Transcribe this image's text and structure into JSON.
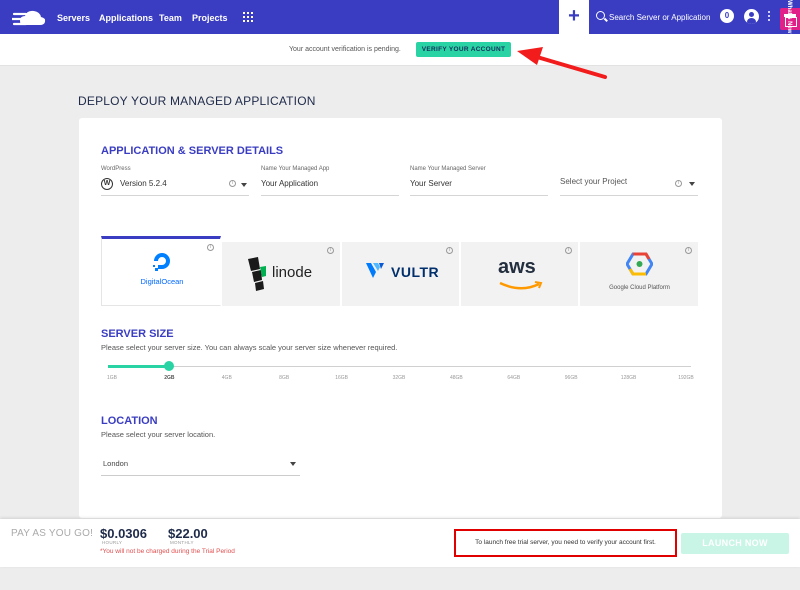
{
  "nav": {
    "items": [
      "Servers",
      "Applications",
      "Team",
      "Projects"
    ],
    "search_placeholder": "Search Server or Application",
    "notification_count": "0",
    "side_tab_label": "What's New"
  },
  "verify": {
    "text": "Your account verification is pending.",
    "button": "VERIFY YOUR ACCOUNT"
  },
  "page_title": "DEPLOY YOUR MANAGED APPLICATION",
  "details": {
    "title": "APPLICATION & SERVER DETAILS",
    "app_label": "WordPress",
    "app_version": "Version 5.2.4",
    "app_name_label": "Name Your Managed App",
    "app_name_value": "Your Application",
    "server_name_label": "Name Your Managed Server",
    "server_name_value": "Your Server",
    "project_placeholder": "Select your Project"
  },
  "providers": [
    {
      "name": "DigitalOcean",
      "active": true
    },
    {
      "name": "linode",
      "active": false
    },
    {
      "name": "VULTR",
      "active": false
    },
    {
      "name": "aws",
      "active": false
    },
    {
      "name": "Google Cloud Platform",
      "active": false
    }
  ],
  "server_size": {
    "title": "SERVER SIZE",
    "description": "Please select your server size. You can always scale your server size whenever required.",
    "sizes": [
      "1GB",
      "2GB",
      "4GB",
      "8GB",
      "16GB",
      "32GB",
      "48GB",
      "64GB",
      "96GB",
      "128GB",
      "192GB"
    ],
    "selected_index": 1
  },
  "location": {
    "title": "LOCATION",
    "description": "Please select your server location.",
    "value": "London"
  },
  "footer": {
    "plan_label": "PAY AS YOU GO!",
    "hourly_price": "$0.0306",
    "hourly_unit": "HOURLY",
    "monthly_price": "$22.00",
    "monthly_unit": "MONTHLY",
    "trial_note": "*You will not be charged during the Trial Period",
    "warning": "To launch free trial server, you need to verify your account first.",
    "launch_button": "LAUNCH NOW"
  },
  "colors": {
    "primary": "#3a3dc1",
    "accent": "#2ad3a3",
    "gift": "#e0218a",
    "warning_border": "#e00000"
  }
}
